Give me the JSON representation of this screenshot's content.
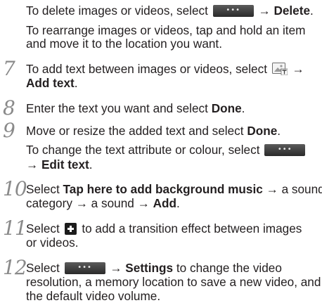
{
  "intro": {
    "l1_a": "To delete images or videos, select ",
    "l1_arrow": " → ",
    "l1_bold": "Delete",
    "l1_end": ".",
    "l2": "To rearrange images or videos, tap and hold an item",
    "l3": "and move it to the location you want."
  },
  "more_button": {
    "label": "•••",
    "icon": "more-options-button"
  },
  "steps": {
    "s7": {
      "num": "7",
      "l1_a": "To add text between images or videos, select ",
      "l1_arrow": " →",
      "l2_bold": "Add text",
      "l2_end": "."
    },
    "s8": {
      "num": "8",
      "a": "Enter the text you want and select ",
      "bold": "Done",
      "end": "."
    },
    "s9": {
      "num": "9",
      "l1_a": "Move or resize the added text and select ",
      "l1_bold": "Done",
      "l1_end": ".",
      "l2_a": "To change the text attribute or colour, select ",
      "l3_arrow": "→ ",
      "l3_bold": "Edit text",
      "l3_end": "."
    },
    "s10": {
      "num": "10",
      "l1_a": "Select ",
      "l1_bold": "Tap here to add background music",
      "l1_b": " → a sound",
      "l2_a": "category → a sound → ",
      "l2_bold": "Add",
      "l2_end": "."
    },
    "s11": {
      "num": "11",
      "l1_a": "Select ",
      "l1_b": " to add a transition effect between images",
      "l2": "or videos."
    },
    "s12": {
      "num": "12",
      "l1_a": "Select ",
      "l1_arrow": " → ",
      "l1_bold": "Settings",
      "l1_b": " to change the video",
      "l2": "resolution, a memory location to save a new video, and",
      "l3": "the default video volume."
    }
  }
}
